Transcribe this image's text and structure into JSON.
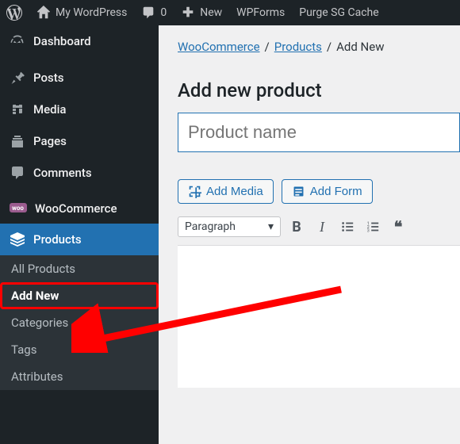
{
  "toolbar": {
    "site_title": "My WordPress",
    "comments_count": "0",
    "new_label": "New",
    "wpforms_label": "WPForms",
    "purge_label": "Purge SG Cache"
  },
  "sidebar": {
    "dashboard": "Dashboard",
    "posts": "Posts",
    "media": "Media",
    "pages": "Pages",
    "comments": "Comments",
    "woocommerce": "WooCommerce",
    "products": "Products",
    "submenu": {
      "all": "All Products",
      "add_new": "Add New",
      "categories": "Categories",
      "tags": "Tags",
      "attributes": "Attributes"
    }
  },
  "breadcrumb": {
    "woocommerce": "WooCommerce",
    "products": "Products",
    "add_new": "Add New"
  },
  "page": {
    "heading": "Add new product",
    "title_placeholder": "Product name",
    "add_media": "Add Media",
    "add_form": "Add Form",
    "format_select": "Paragraph"
  }
}
